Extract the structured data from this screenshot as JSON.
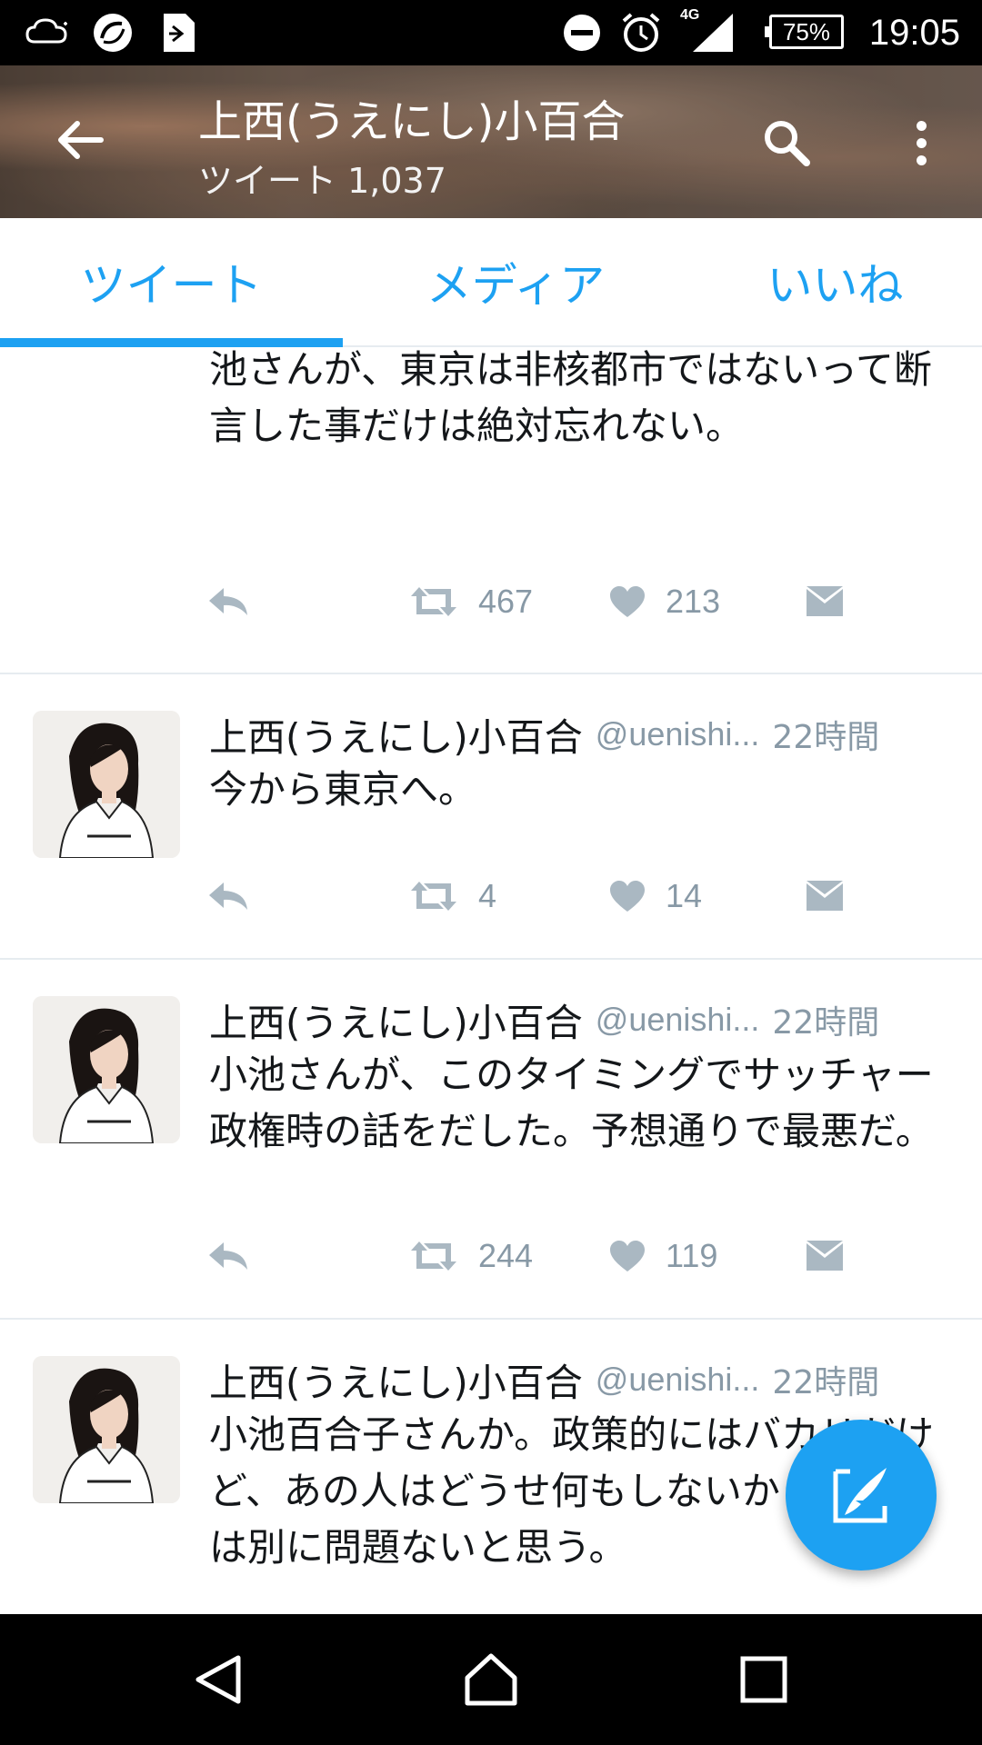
{
  "status_bar": {
    "time": "19:05",
    "battery": "75%",
    "network": "4G",
    "icons": [
      "cloud-icon",
      "sync-icon",
      "sim-icon",
      "do-not-disturb-icon",
      "alarm-icon",
      "signal-icon",
      "battery-icon"
    ]
  },
  "header": {
    "title": "上西(うえにし)小百合",
    "subtitle": "ツイート 1,037",
    "icons": [
      "back-arrow-icon",
      "search-icon",
      "more-vert-icon"
    ]
  },
  "tabs": [
    {
      "label": "ツイート",
      "active": true
    },
    {
      "label": "メディア",
      "active": false
    },
    {
      "label": "いいね",
      "active": false
    }
  ],
  "colors": {
    "accent": "#1da1f2",
    "text": "#14171a",
    "muted": "#8899a6",
    "icon_muted": "#aab8c2",
    "divider": "#e6ecf0"
  },
  "tweets": [
    {
      "text": "政治家は絶対存在してはいけない。ただ小池さんが、東京は非核都市ではないって断言した事だけは絶対忘れない。",
      "retweets": "467",
      "likes": "213"
    },
    {
      "name": "上西(うえにし)小百合",
      "handle": "@uenishi...",
      "time": "22時間",
      "text": "今から東京へ。",
      "retweets": "4",
      "likes": "14"
    },
    {
      "name": "上西(うえにし)小百合",
      "handle": "@uenishi...",
      "time": "22時間",
      "text": "小池さんが、このタイミングでサッチャー政権時の話をだした。予想通りで最悪だ。",
      "retweets": "244",
      "likes": "119"
    },
    {
      "name": "上西(うえにし)小百合",
      "handle": "@uenishi...",
      "time": "22時間",
      "text": "小池百合子さんか。政策的にはバカリだけど、あの人はどうせ何もしないから、東京は別に問題ないと思う。"
    }
  ],
  "fab": {
    "icon": "compose-tweet-icon"
  },
  "nav": {
    "icons": [
      "nav-back-icon",
      "nav-home-icon",
      "nav-recents-icon"
    ]
  }
}
